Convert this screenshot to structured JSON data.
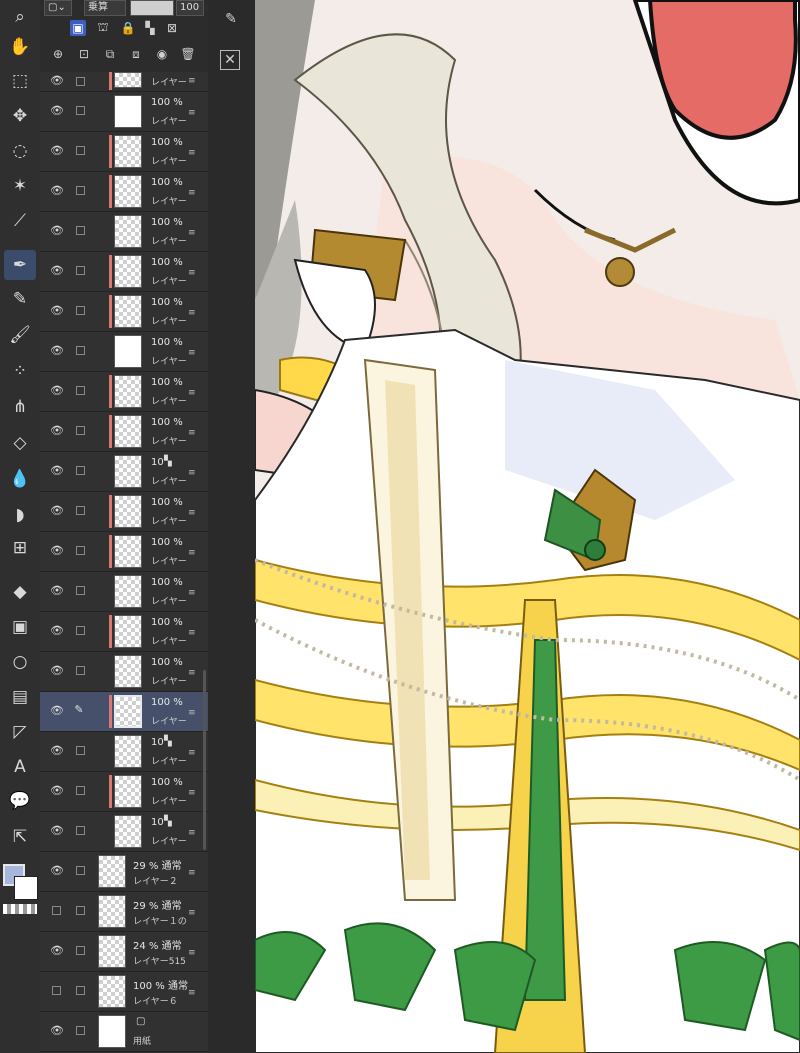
{
  "tools": [
    {
      "name": "zoom-icon",
      "glyph": "⌕"
    },
    {
      "name": "hand-icon",
      "glyph": "✋"
    },
    {
      "name": "object-icon",
      "glyph": "⬚"
    },
    {
      "name": "move-icon",
      "glyph": "✥"
    },
    {
      "name": "lasso-icon",
      "glyph": "◌"
    },
    {
      "name": "magic-wand-icon",
      "glyph": "✶"
    },
    {
      "name": "eyedropper-icon",
      "glyph": "⟋"
    },
    {
      "name": "pen-icon",
      "glyph": "✒"
    },
    {
      "name": "pencil-icon",
      "glyph": "✎"
    },
    {
      "name": "brush-icon",
      "glyph": "🖌"
    },
    {
      "name": "airbrush-icon",
      "glyph": "⁘"
    },
    {
      "name": "decoration-icon",
      "glyph": "⋔"
    },
    {
      "name": "eraser-icon",
      "glyph": "◇"
    },
    {
      "name": "blend-icon",
      "glyph": "💧"
    },
    {
      "name": "blur-icon",
      "glyph": "◗"
    },
    {
      "name": "mesh-transform-icon",
      "glyph": "⊞"
    },
    {
      "name": "fill-icon",
      "glyph": "◆"
    },
    {
      "name": "gradient-icon",
      "glyph": "▣"
    },
    {
      "name": "figure-icon",
      "glyph": "○"
    },
    {
      "name": "frame-icon",
      "glyph": "▤"
    },
    {
      "name": "ruler-icon",
      "glyph": "◸"
    },
    {
      "name": "text-icon",
      "glyph": "A"
    },
    {
      "name": "balloon-icon",
      "glyph": "💬"
    },
    {
      "name": "correct-line-icon",
      "glyph": "⇱"
    }
  ],
  "panel": {
    "blend_mode": "乗算",
    "opacity": "100"
  },
  "layers": [
    {
      "opacity": "",
      "name": "レイヤー",
      "clip": true,
      "thumb": "check"
    },
    {
      "opacity": "100 %",
      "name": "レイヤー",
      "clip": false,
      "thumb": "plain"
    },
    {
      "opacity": "100 %",
      "name": "レイヤー",
      "clip": true,
      "thumb": "check"
    },
    {
      "opacity": "100 %",
      "name": "レイヤー",
      "clip": true,
      "thumb": "check"
    },
    {
      "opacity": "100 %",
      "name": "レイヤー",
      "clip": false,
      "thumb": "check"
    },
    {
      "opacity": "100 %",
      "name": "レイヤー",
      "clip": true,
      "thumb": "check"
    },
    {
      "opacity": "100 %",
      "name": "レイヤー",
      "clip": true,
      "thumb": "check"
    },
    {
      "opacity": "100 %",
      "name": "レイヤー",
      "clip": false,
      "thumb": "plain"
    },
    {
      "opacity": "100 %",
      "name": "レイヤー",
      "clip": true,
      "thumb": "check"
    },
    {
      "opacity": "100 %",
      "name": "レイヤー",
      "clip": true,
      "thumb": "check"
    },
    {
      "opacity": "10",
      "name": "レイヤー",
      "clip": false,
      "thumb": "check",
      "mask": true
    },
    {
      "opacity": "100 %",
      "name": "レイヤー",
      "clip": true,
      "thumb": "check"
    },
    {
      "opacity": "100 %",
      "name": "レイヤー",
      "clip": true,
      "thumb": "check"
    },
    {
      "opacity": "100 %",
      "name": "レイヤー",
      "clip": false,
      "thumb": "check"
    },
    {
      "opacity": "100 %",
      "name": "レイヤー",
      "clip": true,
      "thumb": "check"
    },
    {
      "opacity": "100 %",
      "name": "レイヤー",
      "clip": false,
      "thumb": "check"
    },
    {
      "opacity": "100 %",
      "name": "レイヤー",
      "clip": true,
      "thumb": "check",
      "selected": true
    },
    {
      "opacity": "10",
      "name": "レイヤー",
      "clip": false,
      "thumb": "check",
      "mask": true
    },
    {
      "opacity": "100 %",
      "name": "レイヤー",
      "clip": true,
      "thumb": "check"
    },
    {
      "opacity": "10",
      "name": "レイヤー",
      "clip": false,
      "thumb": "check",
      "mask": true
    }
  ],
  "bottom_layers": [
    {
      "opacity": "29 % 通常",
      "name": "レイヤー２",
      "eye": true
    },
    {
      "opacity": "29 % 通常",
      "name": "レイヤー１の",
      "eye": false
    },
    {
      "opacity": "24 % 通常",
      "name": "レイヤー515",
      "eye": true
    },
    {
      "opacity": "100 % 通常",
      "name": "レイヤー６",
      "eye": false
    },
    {
      "opacity": "",
      "name": "用紙",
      "eye": true
    }
  ]
}
